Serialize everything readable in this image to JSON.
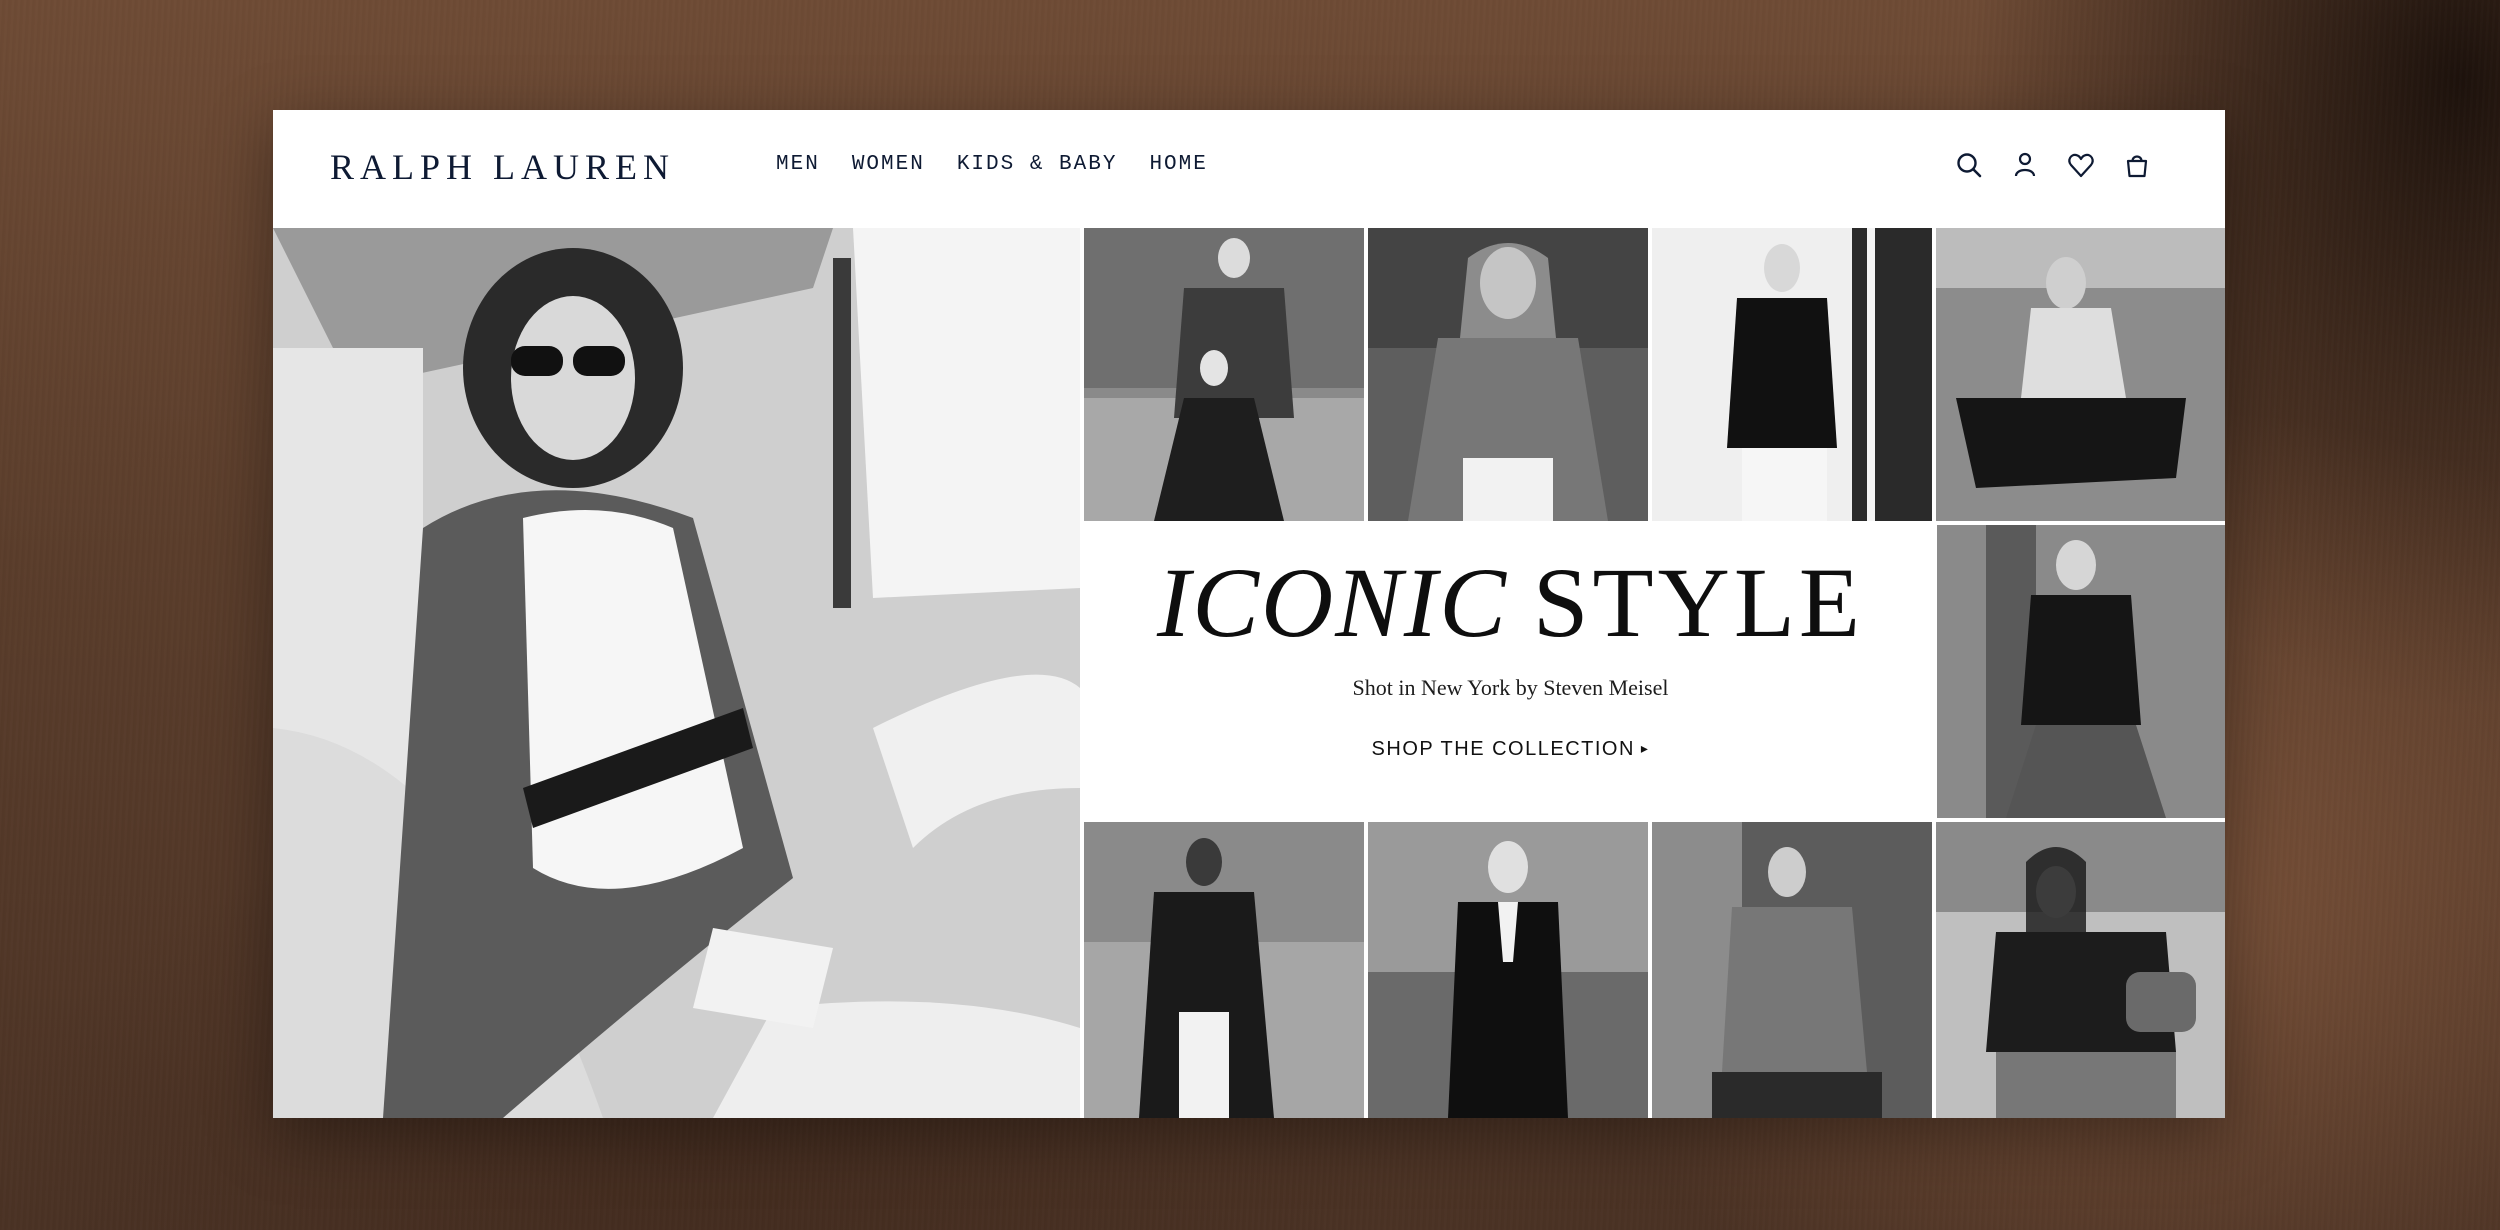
{
  "header": {
    "logo": "RALPH LAUREN",
    "nav": [
      {
        "label": "MEN"
      },
      {
        "label": "WOMEN"
      },
      {
        "label": "KIDS & BABY"
      },
      {
        "label": "HOME"
      }
    ],
    "icons": [
      "search-icon",
      "account-icon",
      "wishlist-heart-icon",
      "shopping-bag-icon"
    ]
  },
  "hero": {
    "headline_italic": "ICONIC",
    "headline_regular": "STYLE",
    "subline": "Shot in New York by Steven Meisel",
    "cta_label": "SHOP THE COLLECTION",
    "cta_arrow": "▸"
  },
  "colors": {
    "brand_navy": "#0e1a33",
    "backdrop_brown": "#5a3d2b"
  }
}
